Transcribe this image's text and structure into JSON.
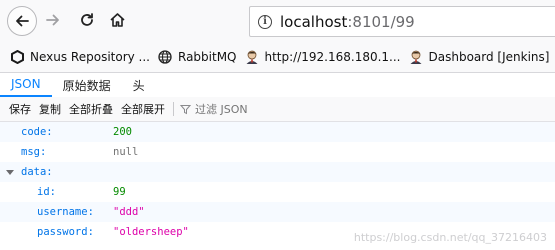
{
  "browser": {
    "url_host": "localhost",
    "url_rest": ":8101/99",
    "bookmarks": [
      {
        "label": "Nexus Repository ...",
        "icon": "nexus-hexagon-icon"
      },
      {
        "label": "RabbitMQ",
        "icon": "globe-icon"
      },
      {
        "label": "http://192.168.180.1...",
        "icon": "jenkins-avatar-icon"
      },
      {
        "label": "Dashboard [Jenkins]",
        "icon": "jenkins-avatar-icon"
      }
    ]
  },
  "viewer": {
    "tabs": [
      "JSON",
      "原始数据",
      "头"
    ],
    "active_tab": "JSON",
    "actions": {
      "save": "保存",
      "copy": "复制",
      "collapse_all": "全部折叠",
      "expand_all": "全部展开",
      "filter_placeholder": "过滤 JSON"
    },
    "rows": [
      {
        "key": "code:",
        "value": "200",
        "type": "number"
      },
      {
        "key": "msg:",
        "value": "null",
        "type": "null"
      },
      {
        "key": "data:",
        "value": "",
        "type": "object"
      },
      {
        "key": "id:",
        "value": "99",
        "type": "number"
      },
      {
        "key": "username:",
        "value": "\"ddd\"",
        "type": "string"
      },
      {
        "key": "password:",
        "value": "\"oldersheep\"",
        "type": "string"
      }
    ]
  },
  "watermark": "https://blog.csdn.net/qq_37216403",
  "colors": {
    "accent": "#0a84ff",
    "key": "#0074e8",
    "number": "#058b00",
    "string": "#dd00a9",
    "null": "#737373"
  }
}
